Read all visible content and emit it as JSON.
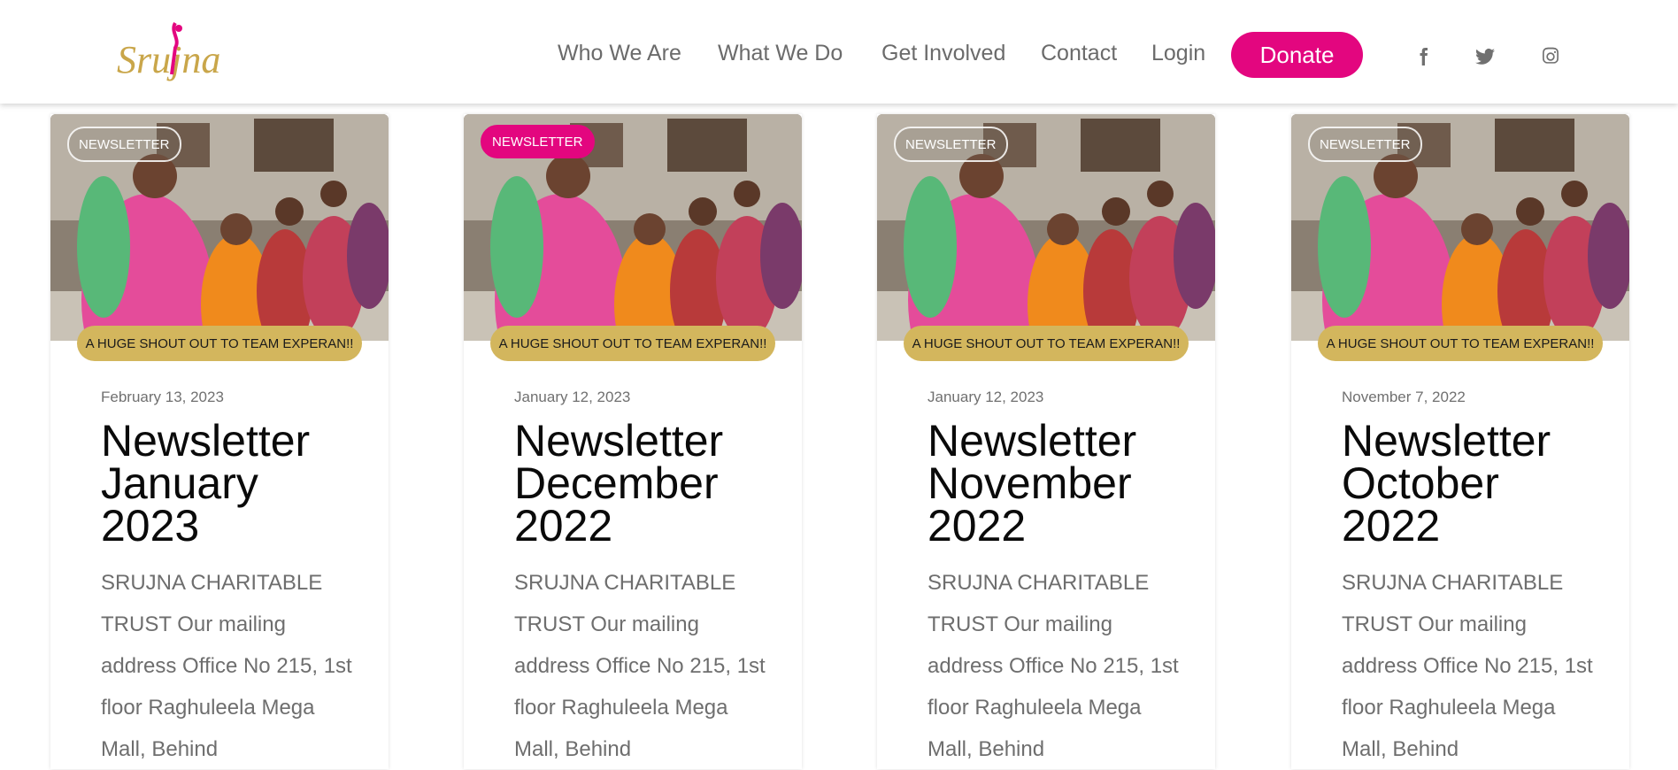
{
  "brand": {
    "logo_text": "Srujna"
  },
  "nav": {
    "items": [
      "Who We Are",
      "What We Do",
      "Get Involved",
      "Contact",
      "Login"
    ],
    "donate_label": "Donate"
  },
  "social": [
    "facebook-icon",
    "twitter-icon",
    "instagram-icon"
  ],
  "colors": {
    "accent": "#e3067f",
    "gold": "#d3b65d",
    "text_gray": "#6e6e6e"
  },
  "cards": [
    {
      "category": "NEWSLETTER",
      "image_title": "A HUGE SHOUT OUT TO TEAM EXPERAN!!",
      "date": "February 13, 2023",
      "title": "Newsletter January 2023",
      "excerpt": "SRUJNA CHARITABLE TRUST Our mailing address Office No 215, 1st floor Raghuleela Mega Mall, Behind"
    },
    {
      "category": "NEWSLETTER",
      "image_title": "A HUGE SHOUT OUT TO TEAM EXPERAN!!",
      "date": "January 12, 2023",
      "title": "Newsletter December 2022",
      "excerpt": "SRUJNA CHARITABLE TRUST Our mailing address Office No 215, 1st floor Raghuleela Mega Mall, Behind"
    },
    {
      "category": "NEWSLETTER",
      "image_title": "A HUGE SHOUT OUT TO TEAM EXPERAN!!",
      "date": "January 12, 2023",
      "title": "Newsletter November 2022",
      "excerpt": "SRUJNA CHARITABLE TRUST Our mailing address Office No 215, 1st floor Raghuleela Mega Mall, Behind"
    },
    {
      "category": "NEWSLETTER",
      "image_title": "A HUGE SHOUT OUT TO TEAM EXPERAN!!",
      "date": "November 7, 2022",
      "title": "Newsletter October 2022",
      "excerpt": "SRUJNA CHARITABLE TRUST Our mailing address Office No 215, 1st floor Raghuleela Mega Mall, Behind"
    }
  ]
}
